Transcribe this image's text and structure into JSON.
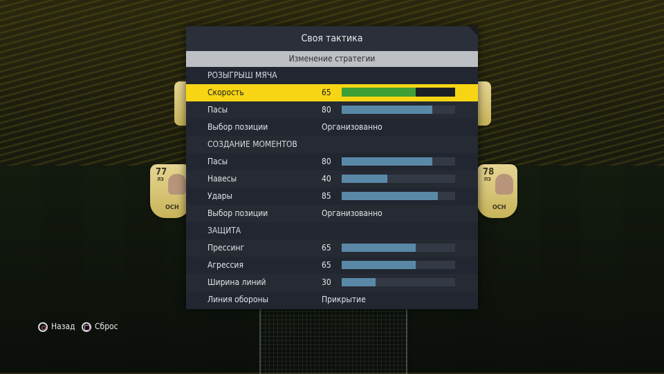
{
  "panel": {
    "title": "Своя тактика",
    "subtitle": "Изменение стратегии"
  },
  "rows": [
    {
      "type": "section",
      "label": "РОЗЫГРЫШ МЯЧА"
    },
    {
      "type": "slider",
      "label": "Скорость",
      "value": "65",
      "percent": 65,
      "selected": true
    },
    {
      "type": "slider",
      "label": "Пасы",
      "value": "80",
      "percent": 80
    },
    {
      "type": "option",
      "label": "Выбор позиции",
      "value": "Организованно"
    },
    {
      "type": "section",
      "label": "СОЗДАНИЕ МОМЕНТОВ"
    },
    {
      "type": "slider",
      "label": "Пасы",
      "value": "80",
      "percent": 80
    },
    {
      "type": "slider",
      "label": "Навесы",
      "value": "40",
      "percent": 40
    },
    {
      "type": "slider",
      "label": "Удары",
      "value": "85",
      "percent": 85
    },
    {
      "type": "option",
      "label": "Выбор позиции",
      "value": "Организованно"
    },
    {
      "type": "section",
      "label": "ЗАЩИТА"
    },
    {
      "type": "slider",
      "label": "Прессинг",
      "value": "65",
      "percent": 65
    },
    {
      "type": "slider",
      "label": "Агрессия",
      "value": "65",
      "percent": 65
    },
    {
      "type": "slider",
      "label": "Ширина линий",
      "value": "30",
      "percent": 30
    },
    {
      "type": "option",
      "label": "Линия обороны",
      "value": "Прикрытие"
    }
  ],
  "footer": {
    "back_label": "Назад",
    "reset_label": "Сброс",
    "back_icon": "circle-button-icon",
    "reset_icon": "square-button-icon"
  },
  "background_cards": [
    {
      "rating": "77",
      "position": "ЛЗ",
      "label": "ОСН"
    },
    {
      "rating": "78",
      "position": "ПЗ",
      "label": "ОСН"
    }
  ],
  "colors": {
    "selected_row": "#f7d515",
    "selected_fill": "#3d9f35",
    "bar_fill": "#5a89a8"
  }
}
